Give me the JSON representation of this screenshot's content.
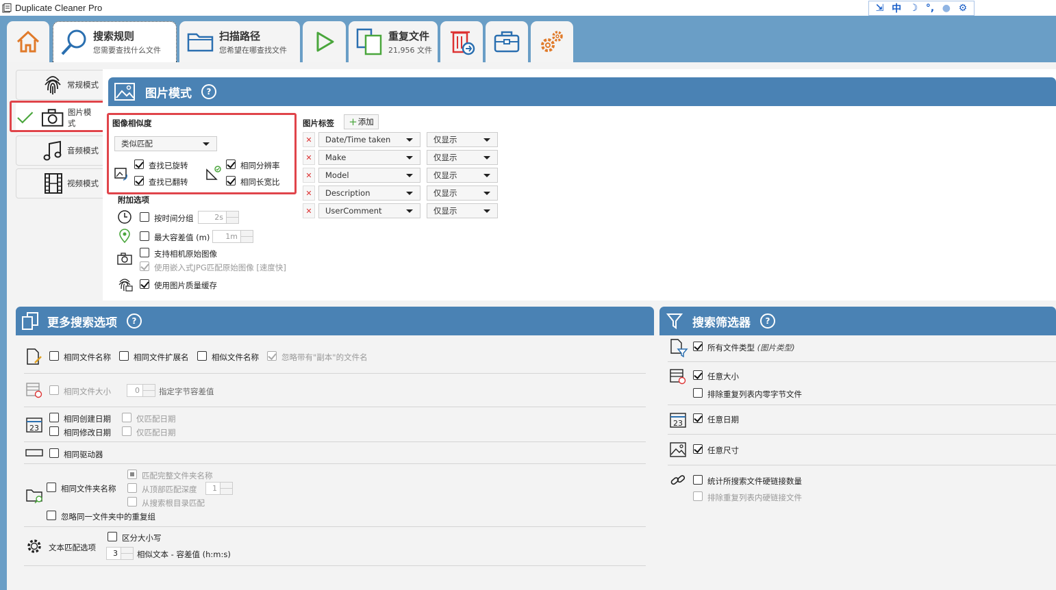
{
  "app": {
    "title": "Duplicate Cleaner Pro",
    "ime": {
      "lang": "中"
    }
  },
  "tabs": [
    {
      "id": "home",
      "title": "",
      "sub": ""
    },
    {
      "id": "search_rules",
      "title": "搜索规则",
      "sub": "您需要查找什么文件"
    },
    {
      "id": "scan_paths",
      "title": "扫描路径",
      "sub": "您希望在哪查找文件"
    },
    {
      "id": "start",
      "title": "",
      "sub": ""
    },
    {
      "id": "duplicates",
      "title": "重复文件",
      "sub": "21,956 文件"
    }
  ],
  "modes": [
    "常规模式",
    "图片模式",
    "音频模式",
    "视频模式"
  ],
  "image_mode": {
    "header": "图片模式",
    "help": "?",
    "similarity": {
      "title": "图像相似度",
      "select": "类似匹配",
      "find_rotated": "查找已旋转",
      "find_flipped": "查找已翻转",
      "same_resolution": "相同分辨率",
      "same_aspect": "相同长宽比"
    },
    "extra": {
      "title": "附加选项",
      "group_time": "按时间分组",
      "group_time_val": "2s",
      "max_tol": "最大容差值 (m)",
      "max_tol_val": "1m",
      "raw_support": "支持相机原始图像",
      "embedded_jpg": "使用嵌入式JPG匹配原始图像 [速度快]",
      "quality_cache": "使用图片质量缓存"
    },
    "tags": {
      "title": "图片标签",
      "add": "添加",
      "rows": [
        {
          "tag": "Date/Time taken",
          "mode": "仅显示"
        },
        {
          "tag": "Make",
          "mode": "仅显示"
        },
        {
          "tag": "Model",
          "mode": "仅显示"
        },
        {
          "tag": "Description",
          "mode": "仅显示"
        },
        {
          "tag": "UserComment",
          "mode": "仅显示"
        }
      ]
    }
  },
  "more_options": {
    "header": "更多搜索选项",
    "same_filename": "相同文件名称",
    "same_ext": "相同文件扩展名",
    "similar_filename": "相似文件名称",
    "ignore_copy": "忽略带有\"副本\"的文件名",
    "same_size": "相同文件大小",
    "size_val": "0",
    "byte_tol": "指定字节容差值",
    "same_created": "相同创建日期",
    "created_only": "仅匹配日期",
    "same_modified": "相同修改日期",
    "modified_only": "仅匹配日期",
    "same_drive": "相同驱动器",
    "match_full_folder": "匹配完整文件夹名称",
    "same_folder": "相同文件夹名称",
    "from_top": "从顶部匹配深度",
    "depth_val": "1",
    "from_root": "从搜索根目录匹配",
    "ignore_same_folder": "忽略同一文件夹中的重复组",
    "text_match": "文本匹配选项",
    "case_sensitive": "区分大小写",
    "similar_text_val": "3",
    "similar_text": "相似文本 - 容差值 (h:m:s)"
  },
  "filters": {
    "header": "搜索筛选器",
    "all_types": "所有文件类型",
    "all_types_note": "(图片类型)",
    "any_size": "任意大小",
    "exclude_zero": "排除重复列表内零字节文件",
    "any_date": "任意日期",
    "any_dimension": "任意尺寸",
    "count_hardlinks": "统计所搜索文件硬链接数量",
    "exclude_hardlinks": "排除重复列表内硬链接文件"
  },
  "colors": {
    "accent": "#4a82b4",
    "tabbar": "#6a9ec6",
    "highlight": "#e0444a",
    "icon_orange": "#e07a2a",
    "icon_green": "#4aa63c"
  }
}
